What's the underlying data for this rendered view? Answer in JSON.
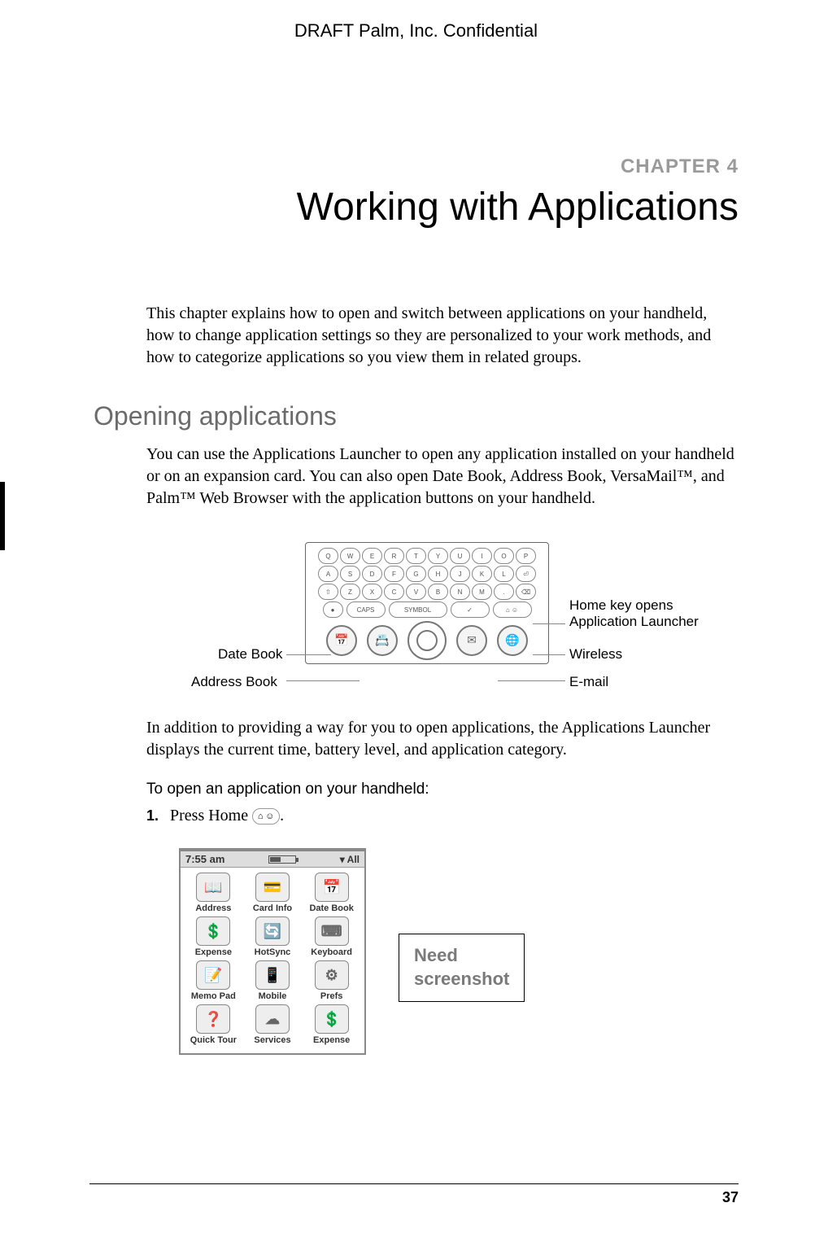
{
  "header": {
    "draft": "DRAFT   Palm, Inc. Confidential"
  },
  "chapter": {
    "label": "CHAPTER 4",
    "title": "Working with Applications"
  },
  "intro": "This chapter explains how to open and switch between applications on your handheld, how to change application settings so they are personalized to your work methods, and how to categorize applications so you view them in related groups.",
  "section1": {
    "heading": "Opening applications",
    "para1": "You can use the Applications Launcher to open any application installed on your handheld or on an expansion card. You can also open Date Book, Address Book, VersaMail™, and Palm™ Web Browser with the application buttons on your handheld.",
    "para2": "In addition to providing a way for you to open applications, the Applications Launcher displays the current time, battery level, and application category."
  },
  "diagram": {
    "keys_row1": [
      "Q",
      "W",
      "E",
      "R",
      "T",
      "Y",
      "U",
      "I",
      "O",
      "P"
    ],
    "keys_row2": [
      "A",
      "S",
      "D",
      "F",
      "G",
      "H",
      "J",
      "K",
      "L",
      "⏎"
    ],
    "keys_row3": [
      "⇧",
      "Z",
      "X",
      "C",
      "V",
      "B",
      "N",
      "M",
      ".",
      "⌫"
    ],
    "fn_row": [
      "●",
      "CAPS",
      "SYMBOL",
      "✓",
      "⌂ ☺"
    ],
    "buttons": [
      "📅",
      "📇",
      "◎",
      "✉",
      "🌐"
    ],
    "callouts": {
      "date_book": "Date Book",
      "address_book": "Address Book",
      "home_line1": "Home key opens",
      "home_line2": "Application Launcher",
      "wireless": "Wireless",
      "email": "E-mail"
    }
  },
  "procedure": {
    "title": "To open an application on your handheld:",
    "step1_num": "1.",
    "step1_text": "Press Home ",
    "step1_after": "."
  },
  "launcher": {
    "time": "7:55 am",
    "category": "▾ All",
    "apps": [
      {
        "icon": "📖",
        "label": "Address"
      },
      {
        "icon": "💳",
        "label": "Card Info"
      },
      {
        "icon": "📅",
        "label": "Date Book"
      },
      {
        "icon": "💲",
        "label": "Expense"
      },
      {
        "icon": "🔄",
        "label": "HotSync"
      },
      {
        "icon": "⌨",
        "label": "Keyboard"
      },
      {
        "icon": "📝",
        "label": "Memo Pad"
      },
      {
        "icon": "📱",
        "label": "Mobile"
      },
      {
        "icon": "⚙",
        "label": "Prefs"
      },
      {
        "icon": "❓",
        "label": "Quick Tour"
      },
      {
        "icon": "☁",
        "label": "Services"
      },
      {
        "icon": "💲",
        "label": "Expense"
      }
    ]
  },
  "note_line1": "Need",
  "note_line2": "screenshot",
  "page_number": "37"
}
